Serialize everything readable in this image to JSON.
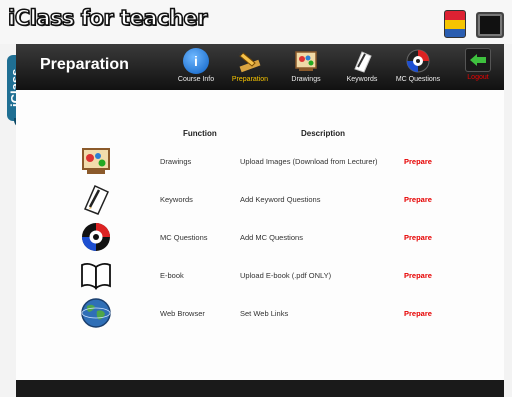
{
  "app": {
    "logo_text": "iClass for teacher",
    "side_tab": "iClass"
  },
  "header": {
    "title": "Preparation"
  },
  "nav": [
    {
      "label": "Course Info",
      "icon": "info-icon"
    },
    {
      "label": "Preparation",
      "icon": "pencil-ruler-icon",
      "active": true
    },
    {
      "label": "Drawings",
      "icon": "palette-icon"
    },
    {
      "label": "Keywords",
      "icon": "note-pencil-icon"
    },
    {
      "label": "MC Questions",
      "icon": "target-icon"
    },
    {
      "label": "Logout",
      "icon": "logout-arrow-icon"
    }
  ],
  "table": {
    "headers": {
      "function": "Function",
      "description": "Description"
    },
    "rows": [
      {
        "function": "Drawings",
        "description": "Upload Images (Download from Lecturer)",
        "action": "Prepare",
        "icon": "palette-icon"
      },
      {
        "function": "Keywords",
        "description": "Add Keyword Questions",
        "action": "Prepare",
        "icon": "note-pencil-icon"
      },
      {
        "function": "MC Questions",
        "description": "Add MC Questions",
        "action": "Prepare",
        "icon": "target-icon"
      },
      {
        "function": "E-book",
        "description": "Upload E-book (.pdf ONLY)",
        "action": "Prepare",
        "icon": "book-icon"
      },
      {
        "function": "Web Browser",
        "description": "Set Web Links",
        "action": "Prepare",
        "icon": "globe-icon"
      }
    ]
  },
  "colors": {
    "accent_tab": "#1f6f93",
    "prepare": "#e60000",
    "nav_bg": "#1a1a1a",
    "active_label": "#f6c400"
  }
}
